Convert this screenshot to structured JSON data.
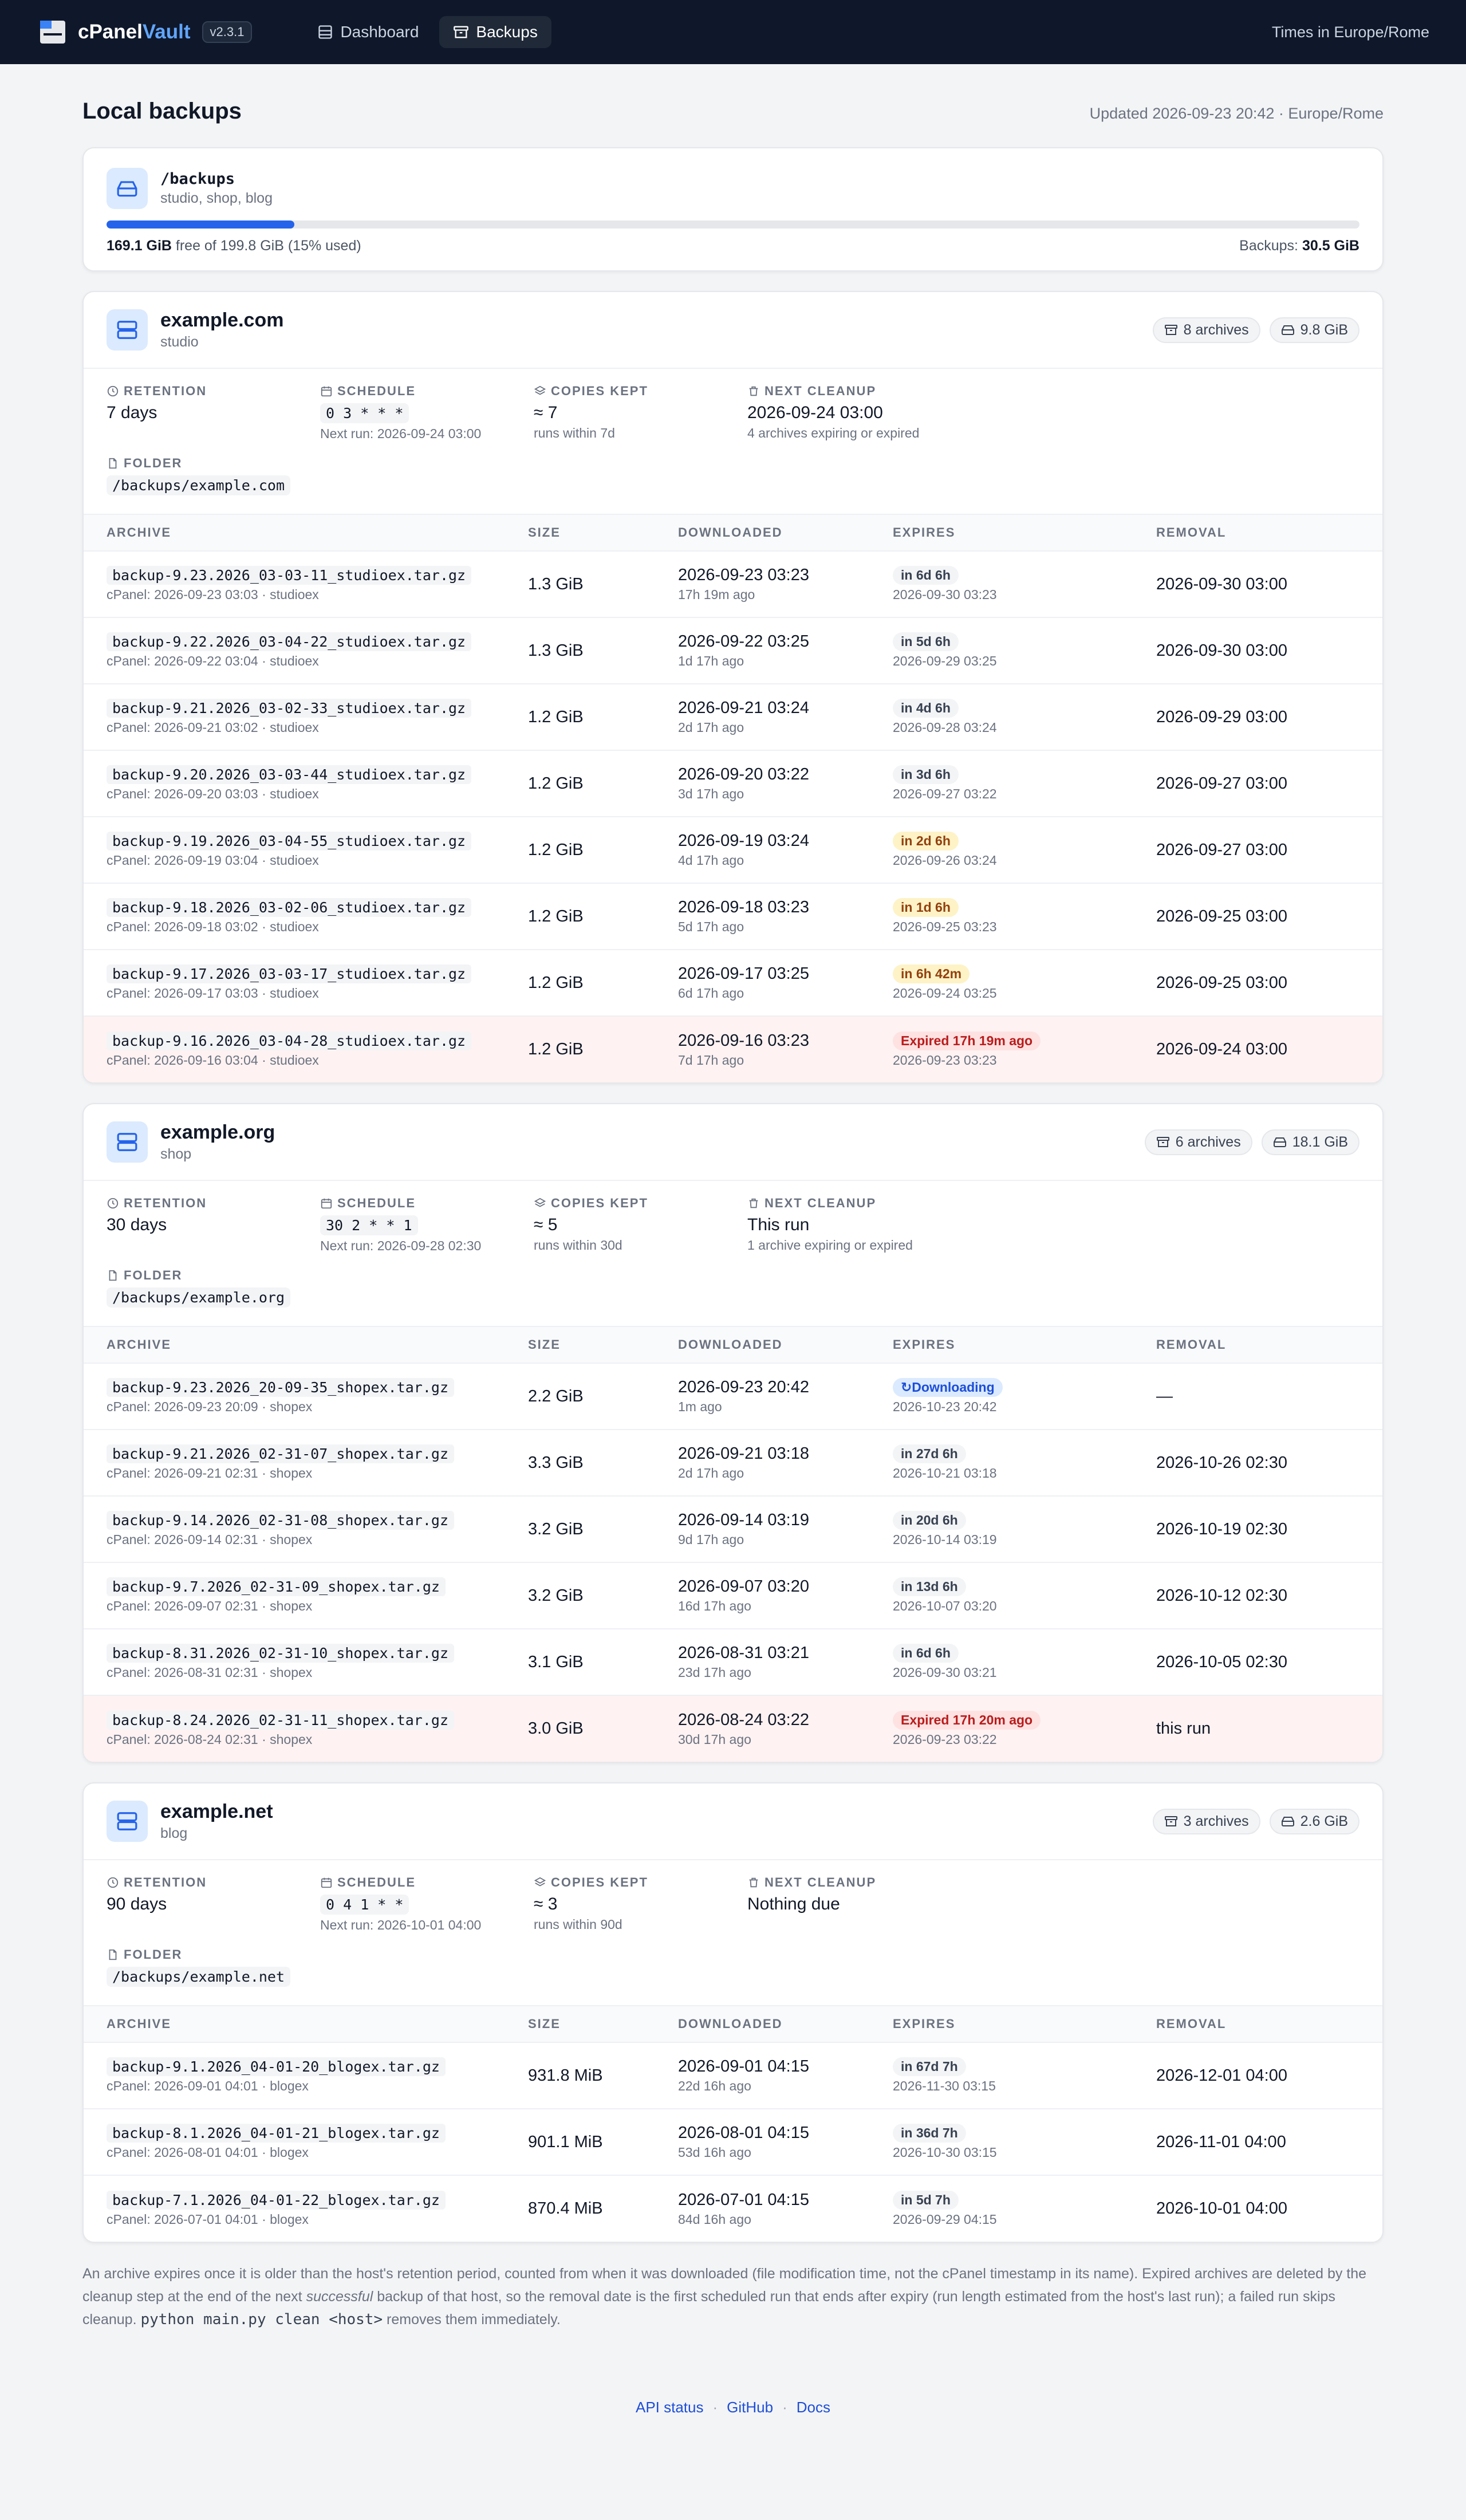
{
  "app": {
    "name_part1": "cPanel",
    "name_part2": "Vault",
    "version": "v2.3.1",
    "nav": [
      {
        "label": "Dashboard",
        "icon": "dashboard-icon"
      },
      {
        "label": "Backups",
        "icon": "archive-icon",
        "active": true
      }
    ],
    "timezone_note": "Times in Europe/Rome"
  },
  "page": {
    "title": "Local backups",
    "updated": "Updated 2026-09-23 20:42 · Europe/Rome"
  },
  "disk": {
    "path": "/backups",
    "hosts": "studio, shop, blog",
    "used_fraction": 0.15,
    "free_value": "169.1 GiB",
    "free_rest": " free of 199.8 GiB (15% used)",
    "backups_label": "Backups: ",
    "backups_value": "30.5 GiB"
  },
  "labels": {
    "retention": "Retention",
    "schedule": "Schedule",
    "copies": "Copies kept",
    "cleanup": "Next cleanup",
    "folder": "Folder",
    "col_archive": "ARCHIVE",
    "col_size": "SIZE",
    "col_downloaded": "DOWNLOADED",
    "col_expires": "EXPIRES",
    "col_removal": "REMOVAL"
  },
  "hosts": [
    {
      "name": "example.com",
      "sub": "studio",
      "archives_chip": "8 archives",
      "size_chip": "9.8 GiB",
      "retention": "7 days",
      "schedule": "0 3 * * *",
      "next_run": "Next run: 2026-09-24 03:00",
      "copies": "≈ 7",
      "copies_sub": "runs within 7d",
      "cleanup": "2026-09-24 03:00",
      "cleanup_sub": "4 archives expiring or expired",
      "folder": "/backups/example.com",
      "rows": [
        {
          "file": "backup-9.23.2026_03-03-11_studioex.tar.gz",
          "sub": "cPanel: 2026-09-23 03:03 · studioex",
          "size": "1.3 GiB",
          "dl": "2026-09-23 03:23",
          "dl_ago": "17h 19m ago",
          "badge": "in 6d 6h",
          "tone": "",
          "exp": "2026-09-30 03:23",
          "removal": "2026-09-30 03:00"
        },
        {
          "file": "backup-9.22.2026_03-04-22_studioex.tar.gz",
          "sub": "cPanel: 2026-09-22 03:04 · studioex",
          "size": "1.3 GiB",
          "dl": "2026-09-22 03:25",
          "dl_ago": "1d 17h ago",
          "badge": "in 5d 6h",
          "tone": "",
          "exp": "2026-09-29 03:25",
          "removal": "2026-09-30 03:00"
        },
        {
          "file": "backup-9.21.2026_03-02-33_studioex.tar.gz",
          "sub": "cPanel: 2026-09-21 03:02 · studioex",
          "size": "1.2 GiB",
          "dl": "2026-09-21 03:24",
          "dl_ago": "2d 17h ago",
          "badge": "in 4d 6h",
          "tone": "",
          "exp": "2026-09-28 03:24",
          "removal": "2026-09-29 03:00"
        },
        {
          "file": "backup-9.20.2026_03-03-44_studioex.tar.gz",
          "sub": "cPanel: 2026-09-20 03:03 · studioex",
          "size": "1.2 GiB",
          "dl": "2026-09-20 03:22",
          "dl_ago": "3d 17h ago",
          "badge": "in 3d 6h",
          "tone": "",
          "exp": "2026-09-27 03:22",
          "removal": "2026-09-27 03:00"
        },
        {
          "file": "backup-9.19.2026_03-04-55_studioex.tar.gz",
          "sub": "cPanel: 2026-09-19 03:04 · studioex",
          "size": "1.2 GiB",
          "dl": "2026-09-19 03:24",
          "dl_ago": "4d 17h ago",
          "badge": "in 2d 6h",
          "tone": "warn",
          "exp": "2026-09-26 03:24",
          "removal": "2026-09-27 03:00"
        },
        {
          "file": "backup-9.18.2026_03-02-06_studioex.tar.gz",
          "sub": "cPanel: 2026-09-18 03:02 · studioex",
          "size": "1.2 GiB",
          "dl": "2026-09-18 03:23",
          "dl_ago": "5d 17h ago",
          "badge": "in 1d 6h",
          "tone": "warn",
          "exp": "2026-09-25 03:23",
          "removal": "2026-09-25 03:00"
        },
        {
          "file": "backup-9.17.2026_03-03-17_studioex.tar.gz",
          "sub": "cPanel: 2026-09-17 03:03 · studioex",
          "size": "1.2 GiB",
          "dl": "2026-09-17 03:25",
          "dl_ago": "6d 17h ago",
          "badge": "in 6h 42m",
          "tone": "warn",
          "exp": "2026-09-24 03:25",
          "removal": "2026-09-25 03:00"
        },
        {
          "file": "backup-9.16.2026_03-04-28_studioex.tar.gz",
          "sub": "cPanel: 2026-09-16 03:04 · studioex",
          "size": "1.2 GiB",
          "dl": "2026-09-16 03:23",
          "dl_ago": "7d 17h ago",
          "badge": "Expired 17h 19m ago",
          "tone": "bad",
          "exp": "2026-09-23 03:23",
          "removal": "2026-09-24 03:00",
          "expired": true
        }
      ]
    },
    {
      "name": "example.org",
      "sub": "shop",
      "archives_chip": "6 archives",
      "size_chip": "18.1 GiB",
      "retention": "30 days",
      "schedule": "30 2 * * 1",
      "next_run": "Next run: 2026-09-28 02:30",
      "copies": "≈ 5",
      "copies_sub": "runs within 30d",
      "cleanup": "This run",
      "cleanup_sub": "1 archive expiring or expired",
      "folder": "/backups/example.org",
      "rows": [
        {
          "file": "backup-9.23.2026_20-09-35_shopex.tar.gz",
          "sub": "cPanel: 2026-09-23 20:09 · shopex",
          "size": "2.2 GiB",
          "dl": "2026-09-23 20:42",
          "dl_ago": "1m ago",
          "badge": "Downloading",
          "tone": "info",
          "exp": "2026-10-23 20:42",
          "removal": "—"
        },
        {
          "file": "backup-9.21.2026_02-31-07_shopex.tar.gz",
          "sub": "cPanel: 2026-09-21 02:31 · shopex",
          "size": "3.3 GiB",
          "dl": "2026-09-21 03:18",
          "dl_ago": "2d 17h ago",
          "badge": "in 27d 6h",
          "tone": "",
          "exp": "2026-10-21 03:18",
          "removal": "2026-10-26 02:30"
        },
        {
          "file": "backup-9.14.2026_02-31-08_shopex.tar.gz",
          "sub": "cPanel: 2026-09-14 02:31 · shopex",
          "size": "3.2 GiB",
          "dl": "2026-09-14 03:19",
          "dl_ago": "9d 17h ago",
          "badge": "in 20d 6h",
          "tone": "",
          "exp": "2026-10-14 03:19",
          "removal": "2026-10-19 02:30"
        },
        {
          "file": "backup-9.7.2026_02-31-09_shopex.tar.gz",
          "sub": "cPanel: 2026-09-07 02:31 · shopex",
          "size": "3.2 GiB",
          "dl": "2026-09-07 03:20",
          "dl_ago": "16d 17h ago",
          "badge": "in 13d 6h",
          "tone": "",
          "exp": "2026-10-07 03:20",
          "removal": "2026-10-12 02:30"
        },
        {
          "file": "backup-8.31.2026_02-31-10_shopex.tar.gz",
          "sub": "cPanel: 2026-08-31 02:31 · shopex",
          "size": "3.1 GiB",
          "dl": "2026-08-31 03:21",
          "dl_ago": "23d 17h ago",
          "badge": "in 6d 6h",
          "tone": "",
          "exp": "2026-09-30 03:21",
          "removal": "2026-10-05 02:30"
        },
        {
          "file": "backup-8.24.2026_02-31-11_shopex.tar.gz",
          "sub": "cPanel: 2026-08-24 02:31 · shopex",
          "size": "3.0 GiB",
          "dl": "2026-08-24 03:22",
          "dl_ago": "30d 17h ago",
          "badge": "Expired 17h 20m ago",
          "tone": "bad",
          "exp": "2026-09-23 03:22",
          "removal": "this run",
          "expired": true
        }
      ]
    },
    {
      "name": "example.net",
      "sub": "blog",
      "archives_chip": "3 archives",
      "size_chip": "2.6 GiB",
      "retention": "90 days",
      "schedule": "0 4 1 * *",
      "next_run": "Next run: 2026-10-01 04:00",
      "copies": "≈ 3",
      "copies_sub": "runs within 90d",
      "cleanup": "Nothing due",
      "cleanup_sub": "",
      "folder": "/backups/example.net",
      "rows": [
        {
          "file": "backup-9.1.2026_04-01-20_blogex.tar.gz",
          "sub": "cPanel: 2026-09-01 04:01 · blogex",
          "size": "931.8 MiB",
          "dl": "2026-09-01 04:15",
          "dl_ago": "22d 16h ago",
          "badge": "in 67d 7h",
          "tone": "",
          "exp": "2026-11-30 03:15",
          "removal": "2026-12-01 04:00"
        },
        {
          "file": "backup-8.1.2026_04-01-21_blogex.tar.gz",
          "sub": "cPanel: 2026-08-01 04:01 · blogex",
          "size": "901.1 MiB",
          "dl": "2026-08-01 04:15",
          "dl_ago": "53d 16h ago",
          "badge": "in 36d 7h",
          "tone": "",
          "exp": "2026-10-30 03:15",
          "removal": "2026-11-01 04:00"
        },
        {
          "file": "backup-7.1.2026_04-01-22_blogex.tar.gz",
          "sub": "cPanel: 2026-07-01 04:01 · blogex",
          "size": "870.4 MiB",
          "dl": "2026-07-01 04:15",
          "dl_ago": "84d 16h ago",
          "badge": "in 5d 7h",
          "tone": "",
          "exp": "2026-09-29 04:15",
          "removal": "2026-10-01 04:00"
        }
      ]
    }
  ],
  "footnote": {
    "part1": "An archive expires once it is older than the host's retention period, counted from when it was downloaded (file modification time, not the cPanel timestamp in its name). Expired archives are deleted by the cleanup step at the end of the next ",
    "italic": "successful",
    "part2": " backup of that host, so the removal date is the first scheduled run that ends after expiry (run length estimated from the host's last run); a failed run skips cleanup. ",
    "command": "python main.py clean <host>",
    "part3": " removes them immediately."
  },
  "footer": {
    "links": [
      "API status",
      "GitHub",
      "Docs"
    ]
  },
  "colors": {
    "topbar": "#0f172a",
    "accent": "#2563eb",
    "warn_badge": "#fef3c7",
    "expired_badge": "#fee2e2",
    "expired_row": "#fef2f2"
  }
}
